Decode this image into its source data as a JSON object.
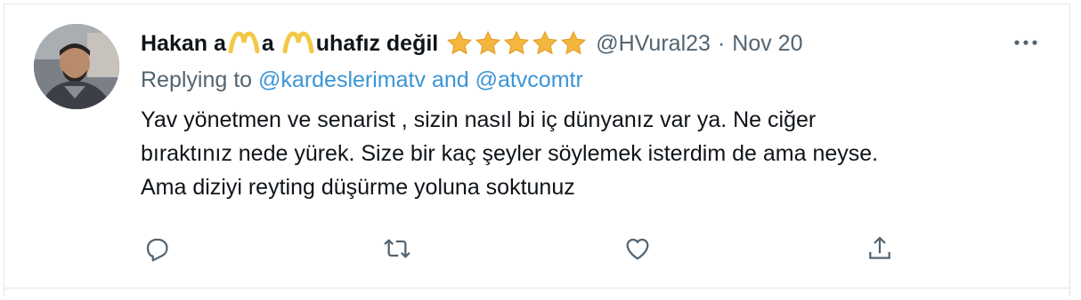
{
  "tweet": {
    "author": {
      "name_part1": "Hakan a",
      "name_part2": "a ",
      "name_part3": "uhafız değil",
      "star_count": 5,
      "handle": "@HVural23",
      "separator": "·",
      "date": "Nov 20"
    },
    "reply": {
      "prefix": "Replying to ",
      "user1": "@kardeslerimatv",
      "conjunction": " and ",
      "user2": "@atvcomtr"
    },
    "text_lines": [
      "Yav yönetmen ve senarist , sizin nasıl bi iç dünyanız var ya. Ne ciğer",
      "bıraktınız nede yürek. Size bir kaç şeyler söylemek isterdim de ama neyse.",
      "Ama diziyi reyting düşürme yoluna soktunuz"
    ],
    "actions": {
      "reply_icon": "reply-icon",
      "retweet_icon": "retweet-icon",
      "like_icon": "heart-icon",
      "share_icon": "share-icon"
    },
    "colors": {
      "link": "#3b95d6",
      "muted": "#536471",
      "star": "#f4b63f",
      "m_icon": "#f3c844"
    }
  }
}
